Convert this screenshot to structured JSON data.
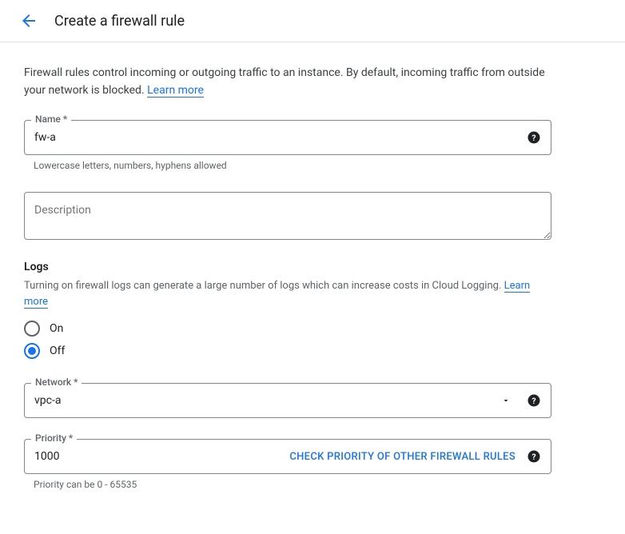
{
  "header": {
    "title": "Create a firewall rule"
  },
  "intro": {
    "text": "Firewall rules control incoming or outgoing traffic to an instance. By default, incoming traffic from outside your network is blocked. ",
    "learn_more": "Learn more"
  },
  "name": {
    "label": "Name *",
    "value": "fw-a",
    "hint": "Lowercase letters, numbers, hyphens allowed"
  },
  "description": {
    "placeholder": "Description"
  },
  "logs": {
    "title": "Logs",
    "desc": "Turning on firewall logs can generate a large number of logs which can increase costs in Cloud Logging. ",
    "learn_more": "Learn more",
    "on": "On",
    "off": "Off"
  },
  "network": {
    "label": "Network *",
    "value": "vpc-a"
  },
  "priority": {
    "label": "Priority *",
    "value": "1000",
    "button": "CHECK PRIORITY OF OTHER FIREWALL RULES",
    "hint": "Priority can be 0 - 65535"
  }
}
